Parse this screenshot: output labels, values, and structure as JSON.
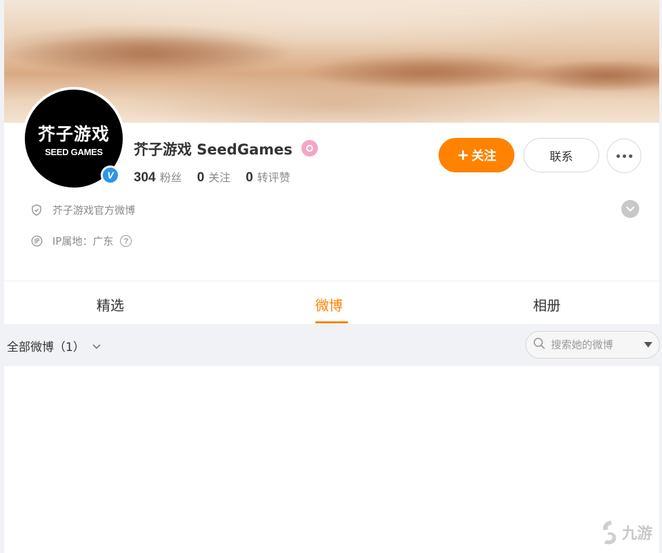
{
  "profile": {
    "avatar_logo_cn": "芥子游戏",
    "avatar_logo_en": "SEED GAMES",
    "verified_mark": "V",
    "name": "芥子游戏 SeedGames",
    "stats": [
      {
        "value": "304",
        "label": "粉丝"
      },
      {
        "value": "0",
        "label": "关注"
      },
      {
        "value": "0",
        "label": "转评赞"
      }
    ],
    "follow_plus": "+",
    "follow_label": "关注",
    "contact_label": "联系",
    "description": "芥子游戏官方微博",
    "ip_location": "IP属地：广东",
    "help_mark": "?"
  },
  "tabs": [
    {
      "label": "精选"
    },
    {
      "label": "微博",
      "active": true
    },
    {
      "label": "相册"
    }
  ],
  "filter": {
    "label": "全部微博（1）",
    "search_placeholder": "搜索她的微博"
  },
  "watermark": "九游",
  "colors": {
    "accent": "#ff8200",
    "verified_blue": "#2d95e8",
    "level_pink": "#f4a5c5",
    "page_bg": "#f1f2f5"
  },
  "icons": [
    "shield-icon",
    "ip-icon",
    "help-icon",
    "expand-icon",
    "more-icon",
    "search-icon",
    "chevron-down-icon",
    "dropdown-caret-icon",
    "verified-icon",
    "level-badge-icon"
  ]
}
